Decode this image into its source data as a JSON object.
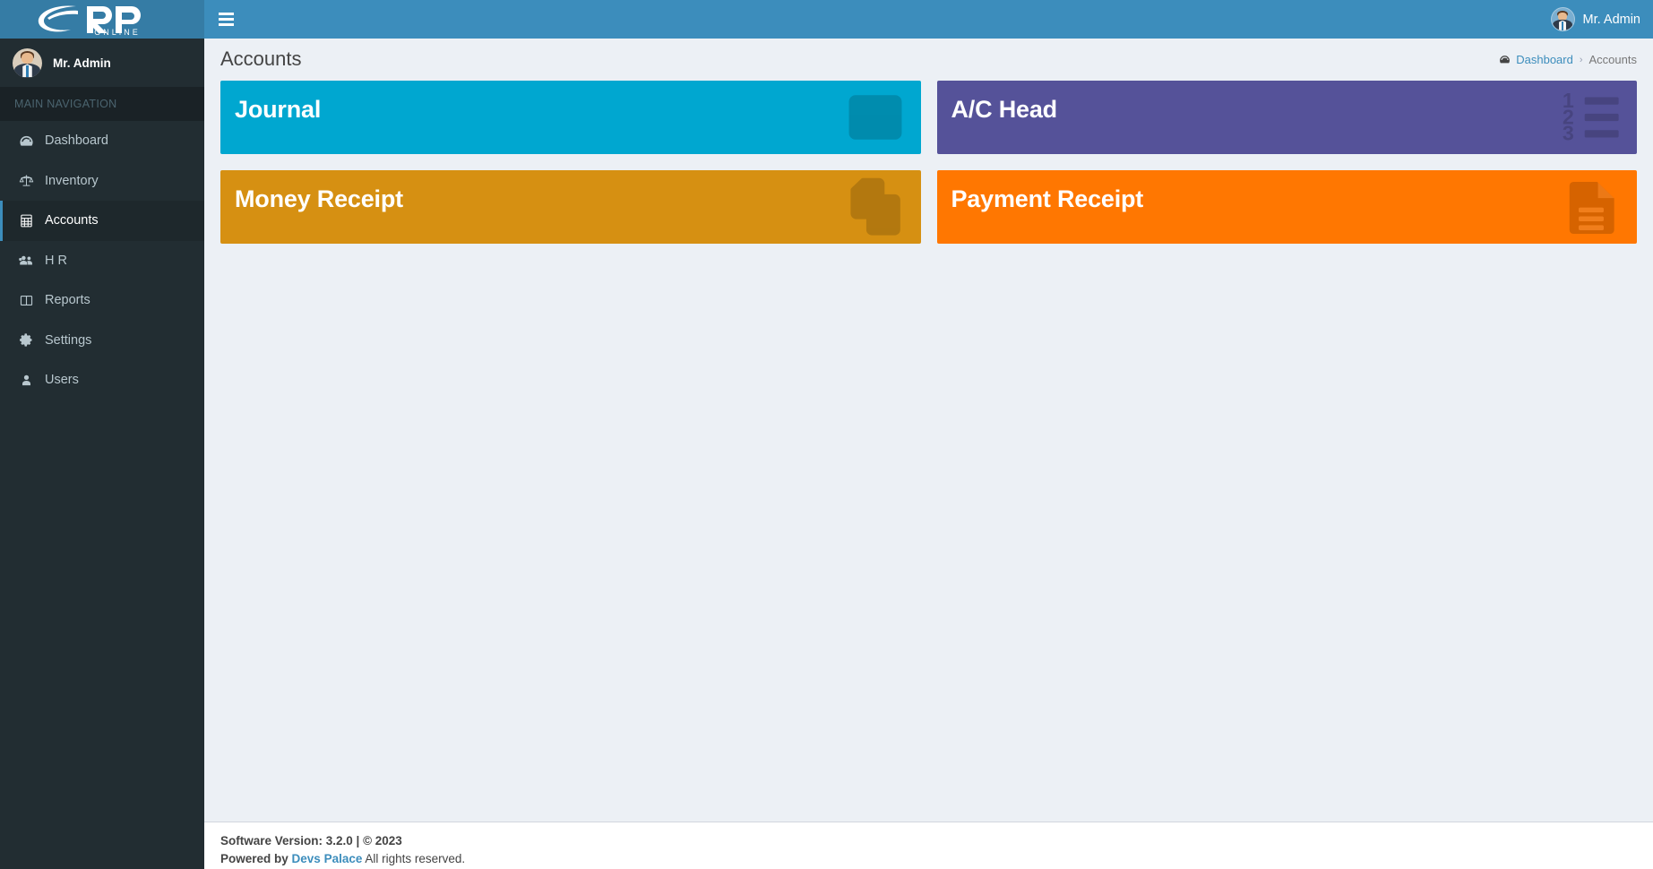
{
  "brand": {
    "logo_text": "eRP",
    "logo_subtext": "ONLINE",
    "header_bg": "#3c8dbc",
    "logo_bg": "#357ca5",
    "sidebar_bg": "#222d32",
    "content_bg": "#ecf0f5"
  },
  "navbar": {
    "toggle_icon": "hamburger-icon",
    "user_name": "Mr. Admin",
    "user_avatar_icon": "user-avatar"
  },
  "sidebar": {
    "user_panel": {
      "name": "Mr. Admin",
      "avatar_icon": "user-avatar"
    },
    "nav_header": "MAIN NAVIGATION",
    "items": [
      {
        "label": "Dashboard",
        "icon": "dashboard-icon",
        "active": false
      },
      {
        "label": "Inventory",
        "icon": "balance-scale-icon",
        "active": false
      },
      {
        "label": "Accounts",
        "icon": "calculator-icon",
        "active": true
      },
      {
        "label": "H R",
        "icon": "users-group-icon",
        "active": false
      },
      {
        "label": "Reports",
        "icon": "columns-icon",
        "active": false
      },
      {
        "label": "Settings",
        "icon": "gear-icon",
        "active": false
      },
      {
        "label": "Users",
        "icon": "user-icon",
        "active": false
      }
    ]
  },
  "content": {
    "page_title": "Accounts",
    "breadcrumb": {
      "home_icon": "dashboard-icon",
      "home_label": "Dashboard",
      "separator": "›",
      "current_label": "Accounts"
    },
    "tiles": [
      {
        "title": "Journal",
        "icon": "columns-icon",
        "color": "#00a7d0"
      },
      {
        "title": "A/C Head",
        "icon": "ordered-list-icon",
        "color": "#555299"
      },
      {
        "title": "Money Receipt",
        "icon": "copy-files-icon",
        "color": "#d69012"
      },
      {
        "title": "Payment Receipt",
        "icon": "file-text-icon",
        "color": "#ff7701"
      }
    ]
  },
  "footer": {
    "version_label": "Software Version: 3.2.0 | © 2023",
    "powered_prefix": "Powered by",
    "powered_link": "Devs Palace",
    "rights_text": "All rights reserved."
  }
}
